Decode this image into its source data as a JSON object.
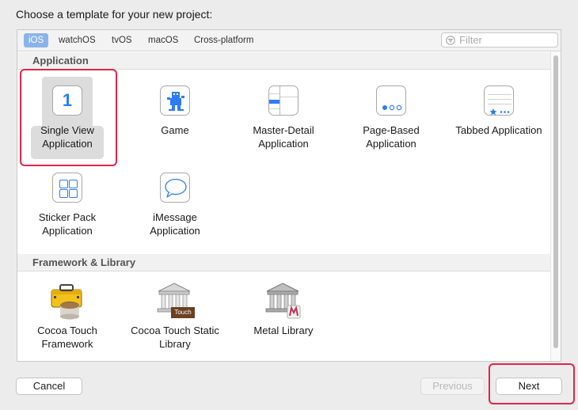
{
  "heading": "Choose a template for your new project:",
  "tabs": [
    {
      "label": "iOS",
      "active": true
    },
    {
      "label": "watchOS",
      "active": false
    },
    {
      "label": "tvOS",
      "active": false
    },
    {
      "label": "macOS",
      "active": false
    },
    {
      "label": "Cross-platform",
      "active": false
    }
  ],
  "filter": {
    "placeholder": "Filter"
  },
  "sections": {
    "application": {
      "title": "Application",
      "items": [
        {
          "label": "Single View Application",
          "icon": "single-view-icon",
          "badge": "1",
          "selected": true
        },
        {
          "label": "Game",
          "icon": "game-icon",
          "selected": false
        },
        {
          "label": "Master-Detail Application",
          "icon": "master-detail-icon",
          "selected": false
        },
        {
          "label": "Page-Based Application",
          "icon": "page-based-icon",
          "selected": false
        },
        {
          "label": "Tabbed Application",
          "icon": "tabbed-icon",
          "selected": false
        },
        {
          "label": "Sticker Pack Application",
          "icon": "sticker-pack-icon",
          "selected": false
        },
        {
          "label": "iMessage Application",
          "icon": "imessage-icon",
          "selected": false
        }
      ]
    },
    "framework": {
      "title": "Framework & Library",
      "items": [
        {
          "label": "Cocoa Touch Framework",
          "icon": "toolbox-icon",
          "selected": false
        },
        {
          "label": "Cocoa Touch Static Library",
          "icon": "library-building-icon",
          "badge": "Touch",
          "selected": false
        },
        {
          "label": "Metal Library",
          "icon": "metal-library-icon",
          "selected": false
        }
      ]
    }
  },
  "buttons": {
    "cancel": "Cancel",
    "previous": "Previous",
    "next": "Next"
  },
  "colors": {
    "accent": "#2d7cf6",
    "highlight": "#e0254a",
    "selected_tab": "#8ab4e8"
  }
}
